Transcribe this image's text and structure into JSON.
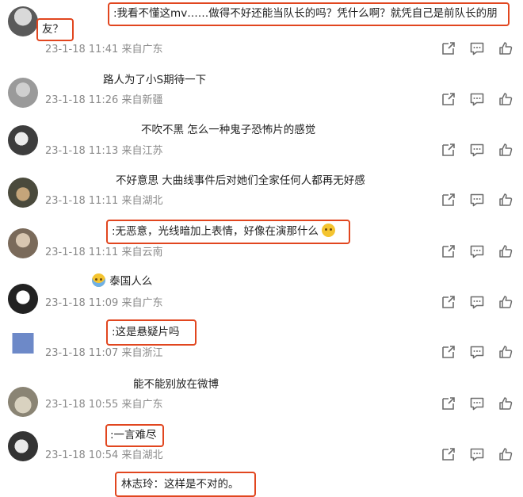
{
  "comments": [
    {
      "line1": ":我看不懂这mv……做得不好还能当队长的吗？凭什么啊？就凭自己是前队长的朋",
      "line2": "友？",
      "time": "23-1-18 11:41",
      "location": "来自广东"
    },
    {
      "text": "路人为了小S期待一下",
      "time": "23-1-18 11:26",
      "location": "来自新疆"
    },
    {
      "text": "不吹不黑 怎么一种鬼子恐怖片的感觉",
      "time": "23-1-18 11:13",
      "location": "来自江苏"
    },
    {
      "text": "不好意思 大曲线事件后对她们全家任何人都再无好感",
      "time": "23-1-18 11:11",
      "location": "来自湖北"
    },
    {
      "text": ":无恶意，光线暗加上表情，好像在演那什么",
      "time": "23-1-18 11:11",
      "location": "来自云南"
    },
    {
      "text": "泰国人么",
      "time": "23-1-18 11:09",
      "location": "来自广东"
    },
    {
      "text": ":这是悬疑片吗",
      "time": "23-1-18 11:07",
      "location": "来自浙江"
    },
    {
      "text": "能不能别放在微博",
      "time": "23-1-18 10:55",
      "location": "来自广东"
    },
    {
      "text": ":一言难尽",
      "time": "23-1-18 10:54",
      "location": "来自湖北"
    },
    {
      "text": "林志玲：这样是不对的。",
      "time": "",
      "location": ""
    }
  ],
  "icons": [
    "share-icon",
    "comment-icon",
    "like-icon"
  ],
  "colors": {
    "highlight": "#e1461f",
    "meta": "#8a8a8a",
    "icon": "#6d6d6d"
  }
}
